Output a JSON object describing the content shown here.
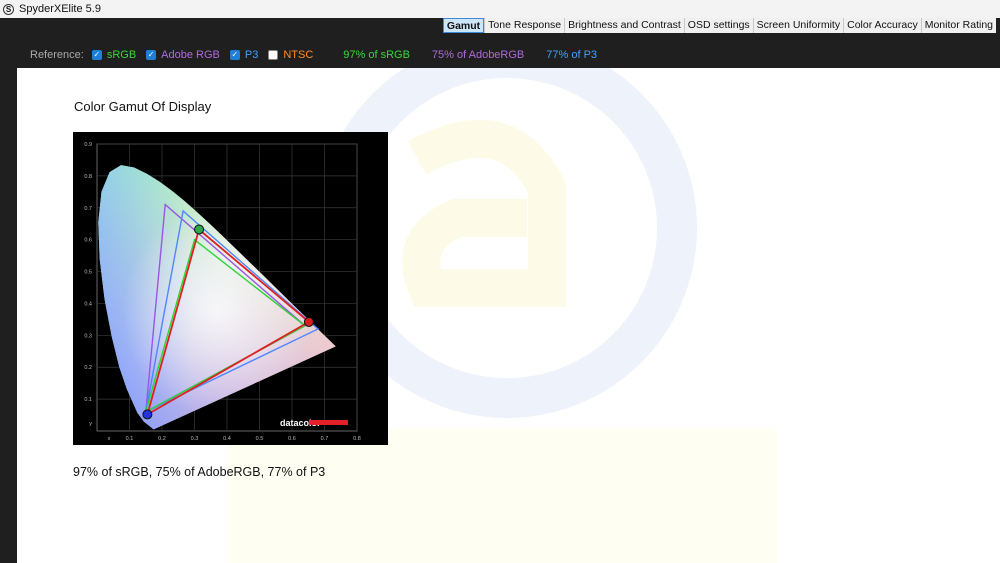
{
  "window": {
    "title": "SpyderXElite 5.9",
    "logo_letter": "S"
  },
  "tabs": [
    {
      "label": "Gamut",
      "active": true
    },
    {
      "label": "Tone Response",
      "active": false
    },
    {
      "label": "Brightness and Contrast",
      "active": false
    },
    {
      "label": "OSD settings",
      "active": false
    },
    {
      "label": "Screen Uniformity",
      "active": false
    },
    {
      "label": "Color Accuracy",
      "active": false
    },
    {
      "label": "Monitor Rating",
      "active": false
    }
  ],
  "reference": {
    "label": "Reference:",
    "items": [
      {
        "label": "sRGB",
        "checked": true,
        "color": "#39d839"
      },
      {
        "label": "Adobe RGB",
        "checked": true,
        "color": "#b06ae0"
      },
      {
        "label": "P3",
        "checked": true,
        "color": "#3fa2ff"
      },
      {
        "label": "NTSC",
        "checked": false,
        "color": "#ff8c2a"
      }
    ],
    "coverage": [
      {
        "text": "97% of sRGB",
        "color": "#39d839"
      },
      {
        "text": "75% of AdobeRGB",
        "color": "#b06ae0"
      },
      {
        "text": "77% of P3",
        "color": "#3fa2ff"
      }
    ]
  },
  "main": {
    "heading": "Color Gamut Of Display",
    "summary": "97% of sRGB, 75% of AdobeRGB, 77% of P3",
    "brand_logo": "datacolor"
  },
  "chart_data": {
    "type": "scatter",
    "title": "",
    "xlabel": "x",
    "ylabel": "y",
    "xlim": [
      0,
      0.8
    ],
    "ylim": [
      0,
      0.9
    ],
    "xticks": [
      0.1,
      0.2,
      0.3,
      0.4,
      0.5,
      0.6,
      0.7,
      0.8
    ],
    "yticks": [
      0.1,
      0.2,
      0.3,
      0.4,
      0.5,
      0.6,
      0.7,
      0.8,
      0.9
    ],
    "grid": true,
    "series": [
      {
        "name": "Adobe RGB",
        "color": "#9a55e6",
        "points": [
          [
            0.64,
            0.33
          ],
          [
            0.21,
            0.71
          ],
          [
            0.15,
            0.06
          ]
        ]
      },
      {
        "name": "P3",
        "color": "#4f86ff",
        "points": [
          [
            0.68,
            0.32
          ],
          [
            0.265,
            0.69
          ],
          [
            0.15,
            0.06
          ]
        ]
      },
      {
        "name": "sRGB",
        "color": "#2fd43a",
        "points": [
          [
            0.64,
            0.33
          ],
          [
            0.3,
            0.6
          ],
          [
            0.15,
            0.06
          ]
        ]
      },
      {
        "name": "Display",
        "color": "#e02020",
        "points": [
          [
            0.652,
            0.342
          ],
          [
            0.314,
            0.632
          ],
          [
            0.155,
            0.052
          ]
        ]
      }
    ]
  }
}
